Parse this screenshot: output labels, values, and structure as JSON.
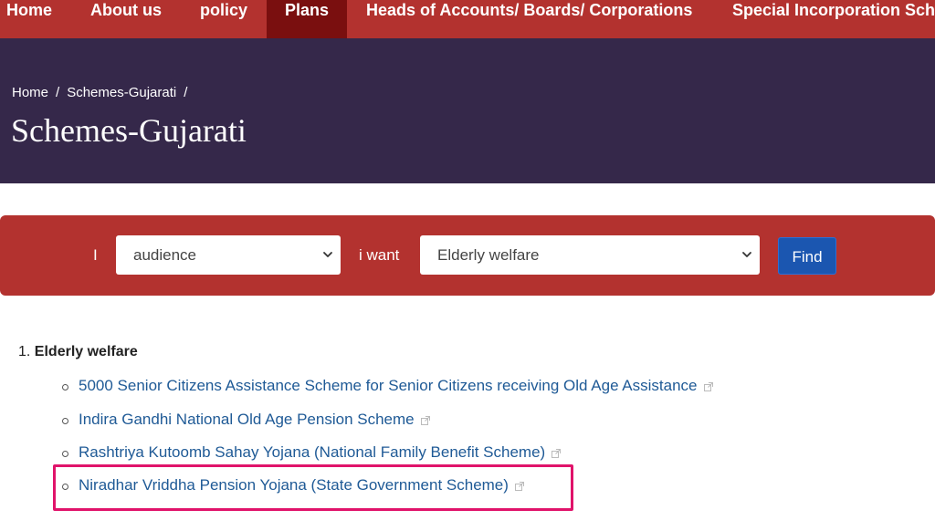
{
  "nav": {
    "items": [
      {
        "label": "Home"
      },
      {
        "label": "About us"
      },
      {
        "label": "policy"
      },
      {
        "label": "Plans",
        "active": true
      },
      {
        "label": "Heads of Accounts/ Boards/ Corporations"
      },
      {
        "label": "Special Incorporation Sch"
      }
    ]
  },
  "breadcrumb": {
    "items": [
      "Home",
      "Schemes-Gujarati"
    ],
    "separator": "/"
  },
  "page": {
    "title": "Schemes-Gujarati"
  },
  "filter": {
    "label_i": "I",
    "audience_value": "audience",
    "label_want": "i want",
    "want_value": "Elderly welfare",
    "find_label": "Find"
  },
  "results": {
    "category_number": "1.",
    "category_title": "Elderly welfare",
    "items": [
      {
        "label": "5000 Senior Citizens Assistance Scheme for Senior Citizens receiving Old Age Assistance"
      },
      {
        "label": "Indira Gandhi National Old Age Pension Scheme"
      },
      {
        "label": "Rashtriya Kutoomb Sahay Yojana (National Family Benefit Scheme)"
      },
      {
        "label": "Niradhar Vriddha Pension Yojana (State Government Scheme)",
        "highlighted": true
      }
    ]
  },
  "colors": {
    "nav_bg": "#b3322f",
    "nav_active_bg": "#7a0f0f",
    "banner_bg": "#35284a",
    "filter_bg": "#b3322f",
    "find_bg": "#1b56b0",
    "link": "#1f5a96",
    "highlight": "#e0136a"
  }
}
